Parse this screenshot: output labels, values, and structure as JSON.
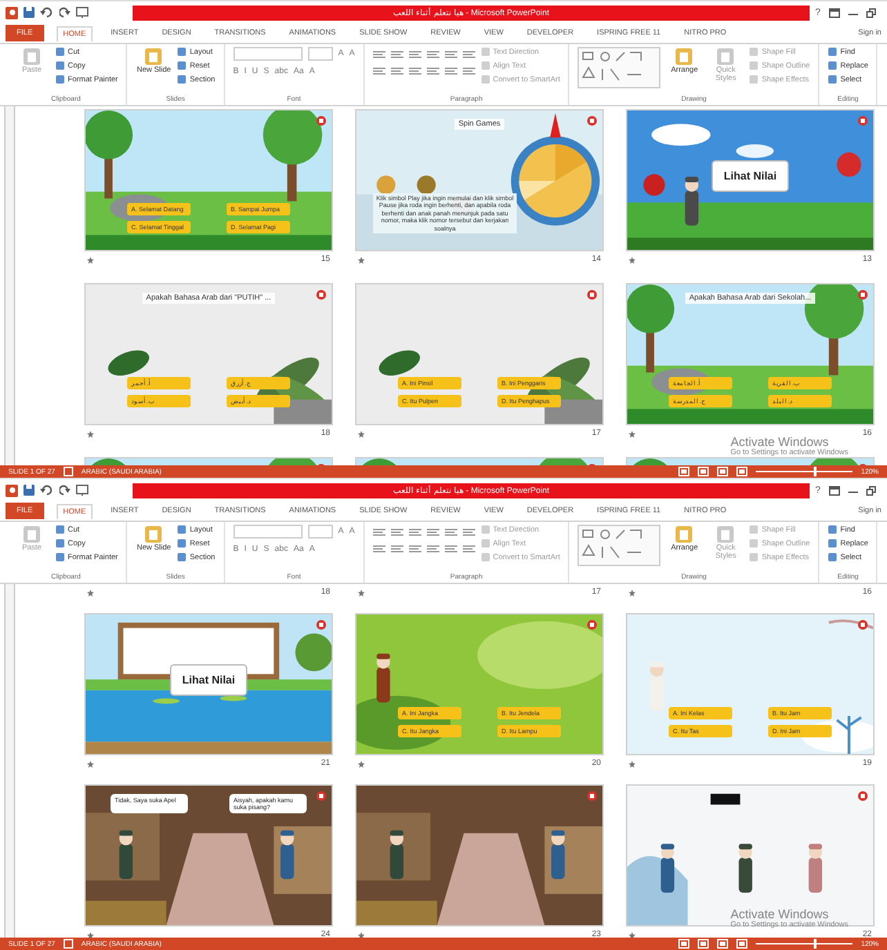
{
  "windows": [
    {
      "title": "هيا نتعلم أثناء اللعب - Microsoft PowerPoint",
      "help": "?",
      "tabs": [
        {
          "label": "FILE",
          "kind": "file",
          "selected": false
        },
        {
          "label": "HOME",
          "kind": "tab",
          "selected": true
        },
        {
          "label": "INSERT",
          "kind": "tab",
          "selected": false
        },
        {
          "label": "DESIGN",
          "kind": "tab",
          "selected": false
        },
        {
          "label": "TRANSITIONS",
          "kind": "tab",
          "selected": false
        },
        {
          "label": "ANIMATIONS",
          "kind": "tab",
          "selected": false
        },
        {
          "label": "SLIDE SHOW",
          "kind": "tab",
          "selected": false
        },
        {
          "label": "REVIEW",
          "kind": "tab",
          "selected": false
        },
        {
          "label": "VIEW",
          "kind": "tab",
          "selected": false
        },
        {
          "label": "DEVELOPER",
          "kind": "tab",
          "selected": false
        },
        {
          "label": "ISPRING FREE 11",
          "kind": "tab",
          "selected": false
        },
        {
          "label": "NITRO PRO",
          "kind": "tab",
          "selected": false
        }
      ],
      "sign_in": "Sign in",
      "ribbon": [
        {
          "label": "Clipboard",
          "items": [
            {
              "kind": "big",
              "label": "Paste",
              "disabled": true
            },
            {
              "kind": "small",
              "label": "Cut",
              "disabled": false
            },
            {
              "kind": "small",
              "label": "Copy",
              "disabled": false
            },
            {
              "kind": "small",
              "label": "Format Painter",
              "disabled": false
            }
          ]
        },
        {
          "label": "Slides",
          "items": [
            {
              "kind": "big",
              "label": "New Slide",
              "disabled": false
            },
            {
              "kind": "small",
              "label": "Layout",
              "disabled": false
            },
            {
              "kind": "small",
              "label": "Reset",
              "disabled": false
            },
            {
              "kind": "small",
              "label": "Section",
              "disabled": false
            }
          ]
        },
        {
          "label": "Font",
          "items": [
            {
              "kind": "font",
              "keys": [
                "A",
                "A"
              ],
              "styles": [
                "B",
                "I",
                "U",
                "S",
                "abc",
                "Aa",
                "A"
              ]
            }
          ]
        },
        {
          "label": "Paragraph",
          "items": [
            {
              "kind": "icons"
            },
            {
              "kind": "small",
              "label": "Text Direction",
              "disabled": true
            },
            {
              "kind": "small",
              "label": "Align Text",
              "disabled": true
            },
            {
              "kind": "small",
              "label": "Convert to SmartArt",
              "disabled": true
            }
          ]
        },
        {
          "label": "Drawing",
          "items": [
            {
              "kind": "gallery"
            },
            {
              "kind": "big",
              "label": "Arrange",
              "disabled": false
            },
            {
              "kind": "big",
              "label": "Quick Styles",
              "disabled": true
            },
            {
              "kind": "small",
              "label": "Shape Fill",
              "disabled": true
            },
            {
              "kind": "small",
              "label": "Shape Outline",
              "disabled": true
            },
            {
              "kind": "small",
              "label": "Shape Effects",
              "disabled": true
            }
          ]
        },
        {
          "label": "Editing",
          "items": [
            {
              "kind": "small",
              "label": "Find",
              "disabled": false
            },
            {
              "kind": "small",
              "label": "Replace",
              "disabled": false
            },
            {
              "kind": "small",
              "label": "Select",
              "disabled": false
            }
          ]
        }
      ],
      "rows": [
        [
          {
            "number": "15",
            "kind": "picture",
            "options": [
              "A. Selamat Datang",
              "B. Sampai Jumpa",
              "C. Selamat Tinggal",
              "D. Selamat Pagi"
            ]
          },
          {
            "number": "14",
            "kind": "picture",
            "title": "Spin Games",
            "text": "Klik simbol Play jika ingin memulai dan klik simbol Pause jika roda ingin berhenti, dan apabila roda berhenti dan anak panah menunjuk pada satu nomor, maka klik nomor tersebut dan kerjakan soalnya"
          },
          {
            "number": "13",
            "kind": "picture",
            "sign": "Lihat Nilai"
          }
        ],
        [
          {
            "number": "18",
            "kind": "picture",
            "title": "Apakah Bahasa Arab dari \"PUTIH\" ...",
            "options": [
              "أ. أحمر",
              "ج. أزرق",
              "ب. أسود",
              "د. أبيض"
            ]
          },
          {
            "number": "17",
            "kind": "picture",
            "options": [
              "A. Ini Pinsil",
              "B. Ini Penggaris",
              "C. Itu Pulpen",
              "D. Itu Penghapus"
            ]
          },
          {
            "number": "16",
            "kind": "picture",
            "title": "Apakah Bahasa Arab dari Sekolah...",
            "options": [
              "أ. الجامعة",
              "ب. القرية",
              "ج. المدرسة",
              "د. البلد"
            ]
          }
        ],
        [
          {
            "kind": "picture"
          },
          {
            "kind": "picture"
          },
          {
            "kind": "picture"
          }
        ]
      ],
      "notice": [
        "Activate Windows",
        "Go to Settings to activate Windows"
      ],
      "status": {
        "slide": "SLIDE 1 OF 27",
        "language": "ARABIC (SAUDI ARABIA)",
        "zoom": "120%",
        "level": 0.6
      }
    },
    {
      "title": "هيا نتعلم أثناء اللعب - Microsoft PowerPoint",
      "help": "?",
      "tabs": [
        {
          "label": "FILE",
          "kind": "file",
          "selected": false
        },
        {
          "label": "HOME",
          "kind": "tab",
          "selected": true
        },
        {
          "label": "INSERT",
          "kind": "tab",
          "selected": false
        },
        {
          "label": "DESIGN",
          "kind": "tab",
          "selected": false
        },
        {
          "label": "TRANSITIONS",
          "kind": "tab",
          "selected": false
        },
        {
          "label": "ANIMATIONS",
          "kind": "tab",
          "selected": false
        },
        {
          "label": "SLIDE SHOW",
          "kind": "tab",
          "selected": false
        },
        {
          "label": "REVIEW",
          "kind": "tab",
          "selected": false
        },
        {
          "label": "VIEW",
          "kind": "tab",
          "selected": false
        },
        {
          "label": "DEVELOPER",
          "kind": "tab",
          "selected": false
        },
        {
          "label": "ISPRING FREE 11",
          "kind": "tab",
          "selected": false
        },
        {
          "label": "NITRO PRO",
          "kind": "tab",
          "selected": false
        }
      ],
      "sign_in": "Sign in",
      "ribbon": [
        {
          "label": "Clipboard",
          "items": [
            {
              "kind": "big",
              "label": "Paste",
              "disabled": true
            },
            {
              "kind": "small",
              "label": "Cut",
              "disabled": false
            },
            {
              "kind": "small",
              "label": "Copy",
              "disabled": false
            },
            {
              "kind": "small",
              "label": "Format Painter",
              "disabled": false
            }
          ]
        },
        {
          "label": "Slides",
          "items": [
            {
              "kind": "big",
              "label": "New Slide",
              "disabled": false
            },
            {
              "kind": "small",
              "label": "Layout",
              "disabled": false
            },
            {
              "kind": "small",
              "label": "Reset",
              "disabled": false
            },
            {
              "kind": "small",
              "label": "Section",
              "disabled": false
            }
          ]
        },
        {
          "label": "Font",
          "items": [
            {
              "kind": "font",
              "keys": [
                "A",
                "A"
              ],
              "styles": [
                "B",
                "I",
                "U",
                "S",
                "abc",
                "Aa",
                "A"
              ]
            }
          ]
        },
        {
          "label": "Paragraph",
          "items": [
            {
              "kind": "icons"
            },
            {
              "kind": "small",
              "label": "Text Direction",
              "disabled": true
            },
            {
              "kind": "small",
              "label": "Align Text",
              "disabled": true
            },
            {
              "kind": "small",
              "label": "Convert to SmartArt",
              "disabled": true
            }
          ]
        },
        {
          "label": "Drawing",
          "items": [
            {
              "kind": "gallery"
            },
            {
              "kind": "big",
              "label": "Arrange",
              "disabled": false
            },
            {
              "kind": "big",
              "label": "Quick Styles",
              "disabled": true
            },
            {
              "kind": "small",
              "label": "Shape Fill",
              "disabled": true
            },
            {
              "kind": "small",
              "label": "Shape Outline",
              "disabled": true
            },
            {
              "kind": "small",
              "label": "Shape Effects",
              "disabled": true
            }
          ]
        },
        {
          "label": "Editing",
          "items": [
            {
              "kind": "small",
              "label": "Find",
              "disabled": false
            },
            {
              "kind": "small",
              "label": "Replace",
              "disabled": false
            },
            {
              "kind": "small",
              "label": "Select",
              "disabled": false
            }
          ]
        }
      ],
      "rows": [
        [
          {
            "number": "18"
          },
          {
            "number": "17"
          },
          {
            "number": "16"
          }
        ],
        [
          {
            "number": "21",
            "kind": "picture",
            "sign": "Lihat Nilai"
          },
          {
            "number": "20",
            "kind": "picture",
            "options": [
              "A. Ini Jangka",
              "B. Itu Jendela",
              "C. Itu Jangka",
              "D. Itu Lampu"
            ]
          },
          {
            "number": "19",
            "kind": "picture",
            "options": [
              "A. Ini Kelas",
              "B. Itu Jam",
              "C. Itu Tas",
              "D. Ini Jam"
            ]
          }
        ],
        [
          {
            "number": "24",
            "kind": "picture",
            "bubbles": [
              "Tidak, Saya suka Apel",
              "Aisyah, apakah kamu suka pisang?"
            ]
          },
          {
            "number": "23",
            "kind": "picture"
          },
          {
            "number": "22",
            "kind": "picture"
          }
        ]
      ],
      "notice": [
        "Activate Windows",
        "Go to Settings to activate Windows"
      ],
      "status": {
        "slide": "SLIDE 1 OF 27",
        "language": "ARABIC (SAUDI ARABIA)",
        "zoom": "120%",
        "level": 0.6
      }
    }
  ]
}
